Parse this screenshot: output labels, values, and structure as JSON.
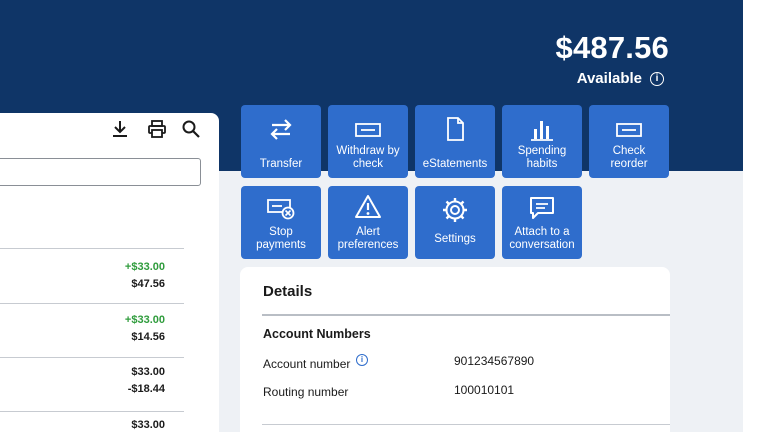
{
  "balance": {
    "amount": "$487.56",
    "label": "Available"
  },
  "transactions": [
    {
      "amount": "+$33.00",
      "balance": "$47.56"
    },
    {
      "amount": "+$33.00",
      "balance": "$14.56"
    },
    {
      "amount": "$33.00",
      "balance": "-$18.44"
    },
    {
      "amount": "$33.00"
    }
  ],
  "tiles": {
    "transfer": "Transfer",
    "withdraw_line1": "Withdraw by",
    "withdraw_line2": "check",
    "estatements": "eStatements",
    "spending_line1": "Spending",
    "spending_line2": "habits",
    "reorder_line1": "Check",
    "reorder_line2": "reorder",
    "stop_line1": "Stop",
    "stop_line2": "payments",
    "alert_line1": "Alert",
    "alert_line2": "preferences",
    "settings": "Settings",
    "attach_line1": "Attach to a",
    "attach_line2": "conversation"
  },
  "details": {
    "title": "Details",
    "section": "Account Numbers",
    "account_label": "Account number",
    "account_value": "901234567890",
    "routing_label": "Routing number",
    "routing_value": "100010101"
  },
  "icons": {
    "download": "download-icon",
    "print": "print-icon",
    "search": "search-icon",
    "info": "info-icon"
  },
  "colors": {
    "header": "#0f3567",
    "tile": "#2f6dcc",
    "credit": "#2f9c3c",
    "background": "#eef1f5"
  }
}
